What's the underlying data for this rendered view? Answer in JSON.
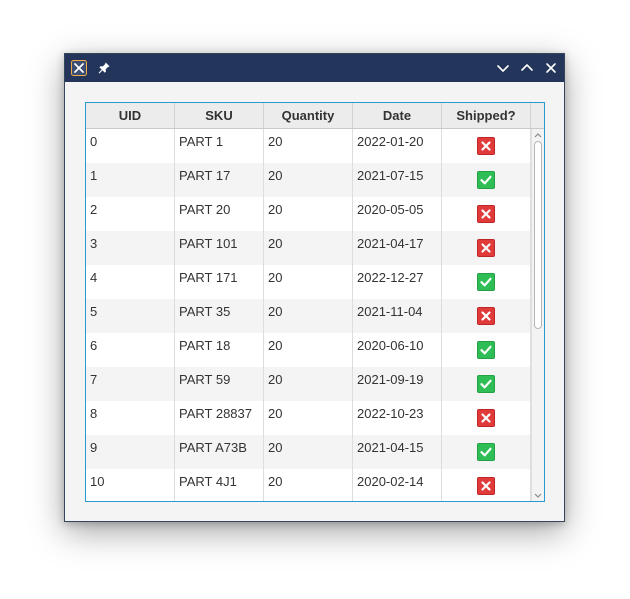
{
  "titlebar": {
    "icons": [
      "app-logo-icon",
      "pin-icon",
      "minimize-icon",
      "maximize-icon",
      "close-icon"
    ]
  },
  "table": {
    "columns": [
      "UID",
      "SKU",
      "Quantity",
      "Date",
      "Shipped?"
    ],
    "rows": [
      {
        "uid": "0",
        "sku": "PART 1",
        "quantity": "20",
        "date": "2022-01-20",
        "shipped": false
      },
      {
        "uid": "1",
        "sku": "PART 17",
        "quantity": "20",
        "date": "2021-07-15",
        "shipped": true
      },
      {
        "uid": "2",
        "sku": "PART 20",
        "quantity": "20",
        "date": "2020-05-05",
        "shipped": false
      },
      {
        "uid": "3",
        "sku": "PART 101",
        "quantity": "20",
        "date": "2021-04-17",
        "shipped": false
      },
      {
        "uid": "4",
        "sku": "PART 171",
        "quantity": "20",
        "date": "2022-12-27",
        "shipped": true
      },
      {
        "uid": "5",
        "sku": "PART 35",
        "quantity": "20",
        "date": "2021-11-04",
        "shipped": false
      },
      {
        "uid": "6",
        "sku": "PART 18",
        "quantity": "20",
        "date": "2020-06-10",
        "shipped": true
      },
      {
        "uid": "7",
        "sku": "PART 59",
        "quantity": "20",
        "date": "2021-09-19",
        "shipped": true
      },
      {
        "uid": "8",
        "sku": "PART 28837",
        "quantity": "20",
        "date": "2022-10-23",
        "shipped": false
      },
      {
        "uid": "9",
        "sku": "PART A73B",
        "quantity": "20",
        "date": "2021-04-15",
        "shipped": true
      },
      {
        "uid": "10",
        "sku": "PART 4J1",
        "quantity": "20",
        "date": "2020-02-14",
        "shipped": false
      }
    ]
  },
  "colors": {
    "titlebar": "#23355a",
    "selection_border": "#2a9bd1",
    "shipped_yes": "#2ebe55",
    "shipped_no": "#e03a3a"
  }
}
